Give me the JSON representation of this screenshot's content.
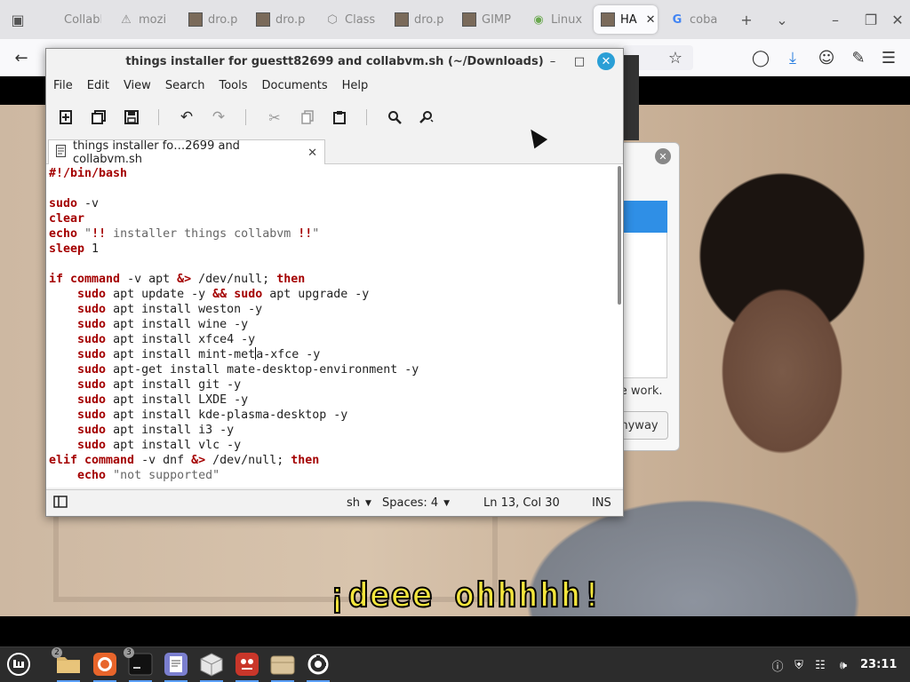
{
  "browser": {
    "tabs": [
      {
        "label": "CollabNe",
        "icon": "collabvm-favicon"
      },
      {
        "label": "mozi",
        "icon": "warning-icon"
      },
      {
        "label": "dro.p",
        "icon": "image-favicon"
      },
      {
        "label": "dro.p",
        "icon": "image-favicon"
      },
      {
        "label": "Class",
        "icon": "class-favicon"
      },
      {
        "label": "dro.p",
        "icon": "image-favicon"
      },
      {
        "label": "GIMP",
        "icon": "image-favicon"
      },
      {
        "label": "Linux",
        "icon": "linux-favicon"
      },
      {
        "label": "HA",
        "icon": "image-favicon",
        "active": true
      },
      {
        "label": "coba",
        "icon": "google-icon"
      }
    ]
  },
  "editor": {
    "title": "things installer for guestt82699 and collabvm.sh (~/Downloads)",
    "menu": [
      "File",
      "Edit",
      "View",
      "Search",
      "Tools",
      "Documents",
      "Help"
    ],
    "tab_label": "things installer fo…2699 and collabvm.sh",
    "status": {
      "language": "sh",
      "indent": "Spaces: 4",
      "position": "Ln 13, Col 30",
      "mode": "INS"
    }
  },
  "background_dialog": {
    "text": "se work.",
    "button": "nyway"
  },
  "video": {
    "subtitle": "¡deee ohhhhh!"
  },
  "taskbar": {
    "clock": "23:11",
    "badges": {
      "files": "2",
      "terminal": "3"
    }
  }
}
